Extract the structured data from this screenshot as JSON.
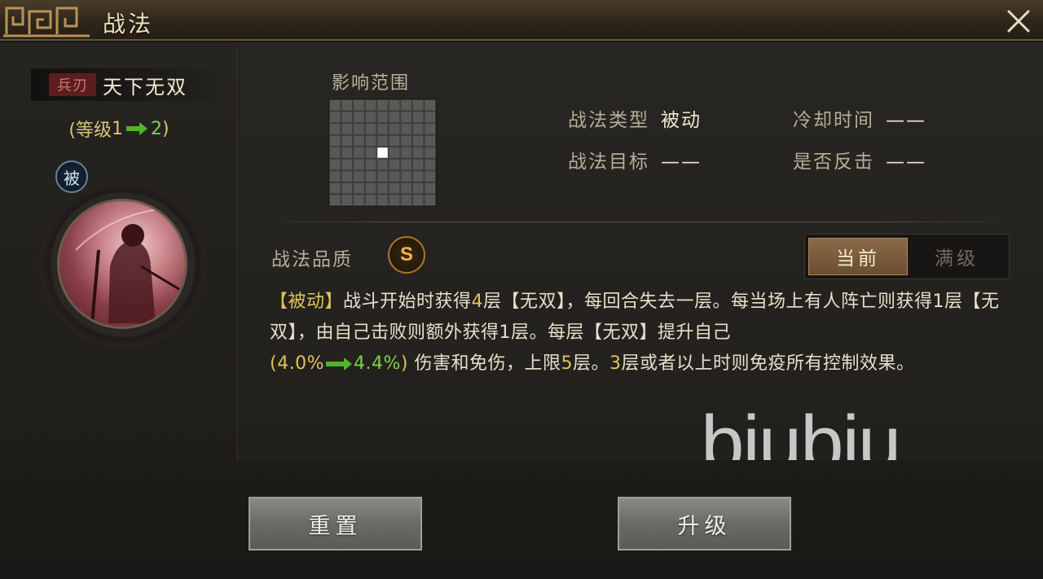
{
  "header": {
    "title": "战法",
    "close_icon": "close-icon"
  },
  "skill": {
    "type_tag": "兵刃",
    "name": "天下无双",
    "level_prefix": "(等级",
    "level_from": "1",
    "level_to": "2",
    "level_suffix": ")",
    "passive_badge": "被"
  },
  "range": {
    "label": "影响范围",
    "grid_size": 9,
    "highlight_row": 5,
    "highlight_col": 5
  },
  "info": {
    "type_label": "战法类型",
    "type_value": "被动",
    "cooldown_label": "冷却时间",
    "cooldown_value": "——",
    "target_label": "战法目标",
    "target_value": "——",
    "counter_label": "是否反击",
    "counter_value": "——"
  },
  "quality": {
    "label": "战法品质",
    "grade": "S"
  },
  "toggle": {
    "current": "当前",
    "max": "满级"
  },
  "description": {
    "tag": "【被动】",
    "p1": "战斗开始时获得",
    "n1": "4",
    "p2": "层【无双】，每回合失去一层。每当场上有人阵亡则获得1层【无双】，由自己击败则额外获得1层。每层【无双】提升自己",
    "pct_open": "(4.0%",
    "pct_to": "4.4%",
    "pct_close": ")",
    "p3": " 伤害和免伤，上限",
    "n2": "5",
    "p4": "层。",
    "n3": "3",
    "p5": "层或者以上时则免疫所有控制效果。"
  },
  "watermark": "biubiu",
  "buttons": {
    "reset": "重置",
    "upgrade": "升级"
  },
  "colors": {
    "accent_gold": "#e0c25a",
    "accent_green": "#7fd04a",
    "passive_red": "#5a1e1e"
  }
}
